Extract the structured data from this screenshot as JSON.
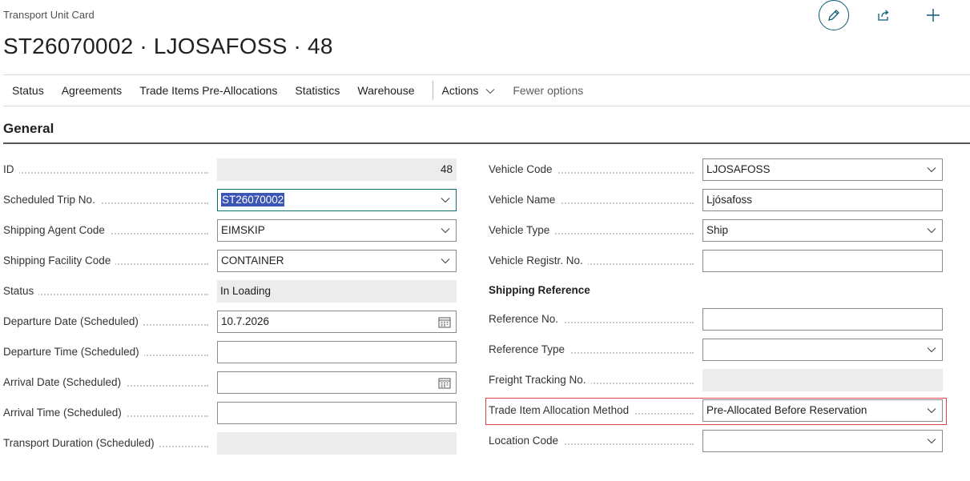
{
  "header": {
    "caption": "Transport Unit Card",
    "title": "ST26070002 · LJOSAFOSS · 48",
    "icons": {
      "edit": "pencil-icon",
      "share": "share-icon",
      "new": "plus-icon"
    }
  },
  "actions": {
    "items": [
      "Status",
      "Agreements",
      "Trade Items Pre-Allocations",
      "Statistics",
      "Warehouse"
    ],
    "menu": "Actions",
    "fewer": "Fewer options"
  },
  "section": {
    "title": "General"
  },
  "left": [
    {
      "label": "ID",
      "value": "48"
    },
    {
      "label": "Scheduled Trip No.",
      "value": "ST26070002"
    },
    {
      "label": "Shipping Agent Code",
      "value": "EIMSKIP"
    },
    {
      "label": "Shipping Facility Code",
      "value": "CONTAINER"
    },
    {
      "label": "Status",
      "value": "In Loading"
    },
    {
      "label": "Departure Date (Scheduled)",
      "value": "10.7.2026"
    },
    {
      "label": "Departure Time (Scheduled)",
      "value": ""
    },
    {
      "label": "Arrival Date (Scheduled)",
      "value": ""
    },
    {
      "label": "Arrival Time (Scheduled)",
      "value": ""
    },
    {
      "label": "Transport Duration (Scheduled)",
      "value": ""
    }
  ],
  "right": [
    {
      "label": "Vehicle Code",
      "value": "LJOSAFOSS"
    },
    {
      "label": "Vehicle Name",
      "value": "Ljósafoss"
    },
    {
      "label": "Vehicle Type",
      "value": "Ship"
    },
    {
      "label": "Vehicle Registr. No.",
      "value": ""
    }
  ],
  "shipping_reference": {
    "title": "Shipping Reference",
    "fields": [
      {
        "label": "Reference No.",
        "value": ""
      },
      {
        "label": "Reference Type",
        "value": ""
      },
      {
        "label": "Freight Tracking No.",
        "value": ""
      },
      {
        "label": "Trade Item Allocation Method",
        "value": "Pre-Allocated Before Reservation"
      },
      {
        "label": "Location Code",
        "value": ""
      }
    ]
  },
  "colors": {
    "accent": "#0e5c75",
    "highlight": "#e0444c",
    "selection": "#3a55b4"
  }
}
